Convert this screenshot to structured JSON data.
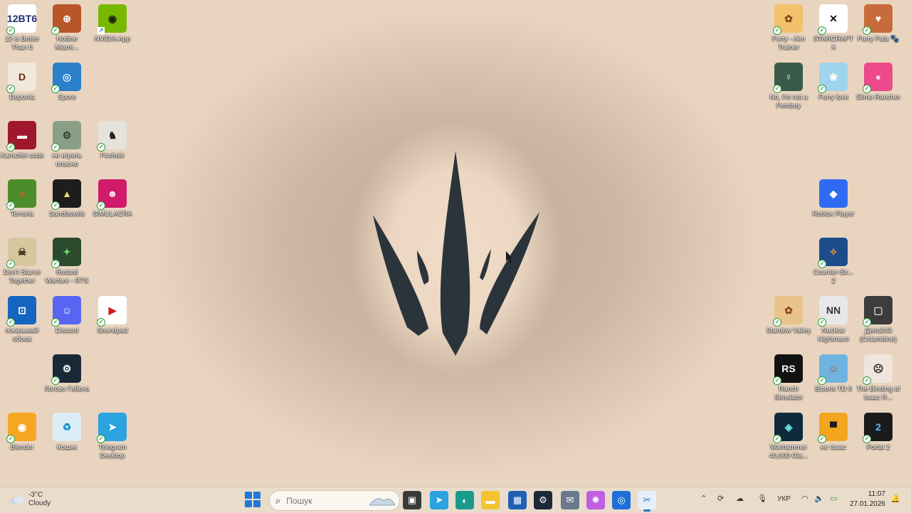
{
  "desktop_icons": [
    {
      "label": "12 is Better Than 6",
      "tile": "12BT6",
      "color": "#ffffff",
      "fg": "#1e2e6e",
      "badge": "check"
    },
    {
      "label": "Hotline Miami...",
      "tile": "⊕",
      "color": "#b8562a",
      "fg": "#ffffff",
      "badge": "check"
    },
    {
      "label": "NVIDIA App",
      "tile": "◉",
      "color": "#76b900",
      "fg": "#1b1b1b",
      "badge": "shortcut"
    },
    {
      "label": "Deponia",
      "tile": "D",
      "color": "#f1e7da",
      "fg": "#6b2a1a",
      "badge": "check"
    },
    {
      "label": "Spore",
      "tile": "◎",
      "color": "#2c7fc9",
      "fg": "#d9f0ff",
      "badge": "check"
    },
    {
      "label": "Karnoffel code",
      "tile": "▬",
      "color": "#a0182e",
      "fg": "#ffffff",
      "badge": "check"
    },
    {
      "label": "не играть опасно",
      "tile": "⚙",
      "color": "#8aa086",
      "fg": "#2f3d2c",
      "badge": "check"
    },
    {
      "label": "Foxhole",
      "tile": "♞",
      "color": "#e6e2dc",
      "fg": "#222222",
      "badge": "check"
    },
    {
      "label": "Terraria",
      "tile": "♣",
      "color": "#4c8d2b",
      "fg": "#a86c2c",
      "badge": "check"
    },
    {
      "label": "Sandboxels",
      "tile": "▲",
      "color": "#1d1d1d",
      "fg": "#e8d66b",
      "badge": "check"
    },
    {
      "label": "SIMULACRA",
      "tile": "☻",
      "color": "#d01a6a",
      "fg": "#ffe2ef",
      "badge": "check"
    },
    {
      "label": "Don't Starve Together",
      "tile": "☠",
      "color": "#d7c79f",
      "fg": "#3b2a15",
      "badge": "check"
    },
    {
      "label": "Rusted Warfare - RTS",
      "tile": "✦",
      "color": "#2b4a2c",
      "fg": "#6fd06f",
      "badge": "check"
    },
    {
      "label": "показывай обоев",
      "tile": "⊡",
      "color": "#1565c0",
      "fg": "#ffffff",
      "badge": "check"
    },
    {
      "label": "Discord",
      "tile": "☺",
      "color": "#5865f2",
      "fg": "#ffffff",
      "badge": "check"
    },
    {
      "label": "Soundpad",
      "tile": "▶",
      "color": "#ffffff",
      "fg": "#d31b1b",
      "badge": "check"
    },
    {
      "label": "Логово Габена",
      "tile": "⚙",
      "color": "#1b2838",
      "fg": "#ffffff",
      "badge": "check"
    },
    {
      "label": "Blender",
      "tile": "◉",
      "color": "#f5a623",
      "fg": "#ffffff",
      "badge": "check"
    },
    {
      "label": "Кошик",
      "tile": "♻",
      "color": "#dbeef8",
      "fg": "#1a8ad4",
      "badge": "none"
    },
    {
      "label": "Telegram Desktop",
      "tile": "➤",
      "color": "#2aa3e0",
      "fg": "#ffffff",
      "badge": "check"
    },
    {
      "label": "Furry - Aim Trainer",
      "tile": "✿",
      "color": "#f3c06b",
      "fg": "#7a4a1a",
      "badge": "check"
    },
    {
      "label": "STARCRAFT X",
      "tile": "✕",
      "color": "#ffffff",
      "fg": "#111111",
      "badge": "check"
    },
    {
      "label": "Furry Futa 🐾",
      "tile": "♥",
      "color": "#c86b3a",
      "fg": "#ffffff",
      "badge": "check"
    },
    {
      "label": "No, I'm not a Femboy",
      "tile": "♀",
      "color": "#3a5a4a",
      "fg": "#ffffff",
      "badge": "check"
    },
    {
      "label": "Furry love",
      "tile": "❀",
      "color": "#9fd4ec",
      "fg": "#ffffff",
      "badge": "check"
    },
    {
      "label": "Slime Rancher",
      "tile": "●",
      "color": "#ec4a8a",
      "fg": "#ffd0e4",
      "badge": "check"
    },
    {
      "label": "Roblox Player",
      "tile": "◆",
      "color": "#2f6bf2",
      "fg": "#ffffff",
      "badge": "none"
    },
    {
      "label": "Counter-Str... 2",
      "tile": "✧",
      "color": "#1d4c8c",
      "fg": "#f0a020",
      "badge": "check"
    },
    {
      "label": "Stardew Valley",
      "tile": "✿",
      "color": "#e9c48a",
      "fg": "#8a4a1a",
      "badge": "check"
    },
    {
      "label": "Nuclear Nightmare",
      "tile": "NN",
      "color": "#e8e8e8",
      "fg": "#333333",
      "badge": "check"
    },
    {
      "label": "Дело243 (Columbine)",
      "tile": "▢",
      "color": "#3c3c3c",
      "fg": "#d0d0d0",
      "badge": "check"
    },
    {
      "label": "Ranch Simulator",
      "tile": "RS",
      "color": "#111111",
      "fg": "#ffffff",
      "badge": "check"
    },
    {
      "label": "Bloons TD 6",
      "tile": "☺",
      "color": "#6fb3e0",
      "fg": "#a05a2a",
      "badge": "check"
    },
    {
      "label": "The Binding of Isaac R...",
      "tile": "☹",
      "color": "#efe5dc",
      "fg": "#222222",
      "badge": "check"
    },
    {
      "label": "Warhammer 40,000 Gla...",
      "tile": "◈",
      "color": "#0f2a3c",
      "fg": "#62e0e0",
      "badge": "check"
    },
    {
      "label": "не Isaac",
      "tile": "▀",
      "color": "#f3a51e",
      "fg": "#1b1b1b",
      "badge": "check"
    },
    {
      "label": "Portal 2",
      "tile": "2",
      "color": "#1b1b1b",
      "fg": "#5ab8ff",
      "badge": "check"
    }
  ],
  "taskbar": {
    "weather_temp": "-3°C",
    "weather_desc": "Cloudy",
    "search_placeholder": "Пошук",
    "apps": [
      {
        "name": "task-view",
        "glyph": "▣",
        "color": "#3a3a3a"
      },
      {
        "name": "telegram",
        "glyph": "➤",
        "color": "#2aa3e0"
      },
      {
        "name": "edge",
        "glyph": "◐",
        "color": "#1a9a8a"
      },
      {
        "name": "file-explorer",
        "glyph": "▬",
        "color": "#f4c430"
      },
      {
        "name": "microsoft-store",
        "glyph": "▦",
        "color": "#1f5fb6"
      },
      {
        "name": "steam",
        "glyph": "⚙",
        "color": "#1b2838"
      },
      {
        "name": "mail",
        "glyph": "✉",
        "color": "#6a7a8a"
      },
      {
        "name": "copilot",
        "glyph": "✺",
        "color": "#c060e0"
      },
      {
        "name": "screen-tool",
        "glyph": "◎",
        "color": "#1d6fd6"
      },
      {
        "name": "snipping-tool",
        "glyph": "✂",
        "color": "#e8eef8"
      }
    ],
    "keyboard_layout": "УКР",
    "time": "11:07",
    "date": "27.01.2026"
  }
}
